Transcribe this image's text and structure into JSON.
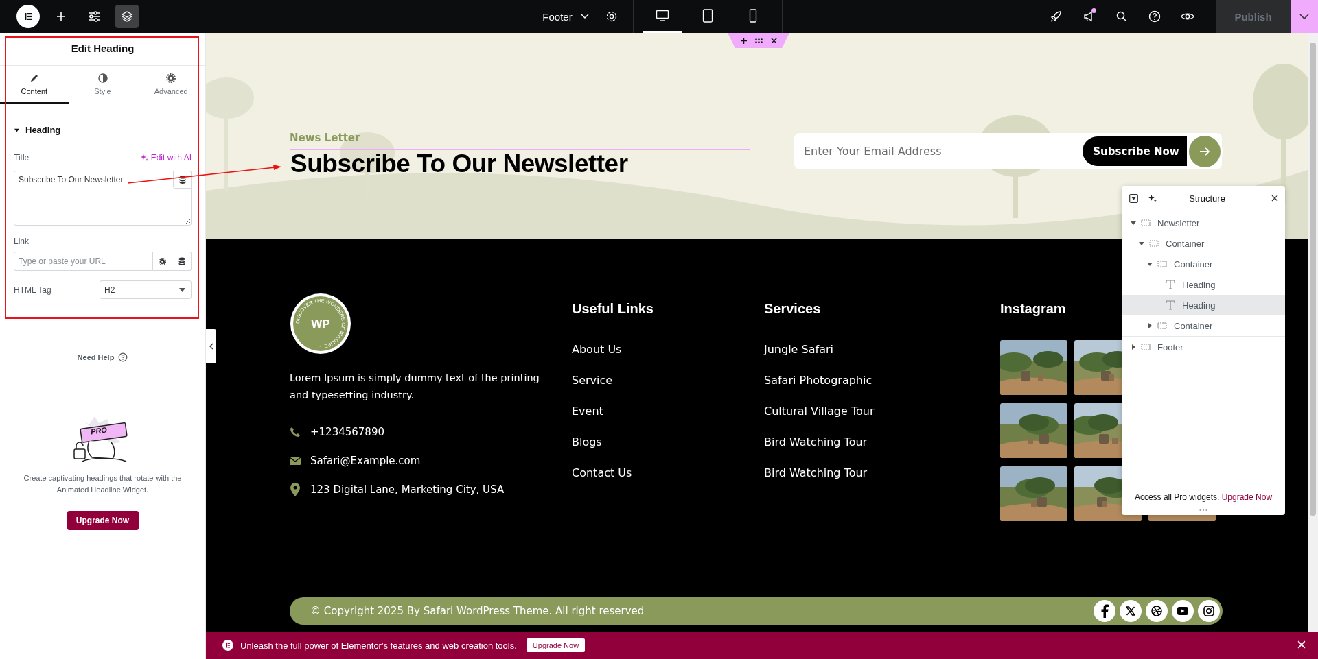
{
  "top_bar": {
    "left_tools": [
      {
        "kind": "add",
        "selected": false
      },
      {
        "kind": "sliders",
        "selected": false
      },
      {
        "kind": "layers",
        "selected": true
      }
    ],
    "document": {
      "title": "Footer"
    },
    "devices": [
      {
        "kind": "desktop",
        "selected": true
      },
      {
        "kind": "tablet",
        "selected": false
      },
      {
        "kind": "mobile",
        "selected": false
      }
    ],
    "right_tools": [
      {
        "kind": "rocket",
        "badge": false
      },
      {
        "kind": "megaphone",
        "badge": true
      },
      {
        "kind": "search",
        "badge": false
      },
      {
        "kind": "help",
        "badge": false
      },
      {
        "kind": "preview",
        "badge": false
      }
    ],
    "publish": {
      "label": "Publish",
      "disabled": true
    }
  },
  "panel": {
    "title": "Edit Heading",
    "tabs": [
      {
        "label": "Content",
        "kind": "pencil",
        "selected": true
      },
      {
        "label": "Style",
        "kind": "contrast",
        "selected": false
      },
      {
        "label": "Advanced",
        "kind": "gear",
        "selected": false
      }
    ],
    "section": {
      "title": "Heading",
      "expanded": true
    },
    "title_field": {
      "label": "Title",
      "ai_action": "Edit with AI",
      "value": "Subscribe To Our Newsletter"
    },
    "link_field": {
      "label": "Link",
      "placeholder": "Type or paste your URL"
    },
    "tag_field": {
      "label": "HTML Tag",
      "value": "H2"
    },
    "help": "Need Help",
    "promo": {
      "badge": "PRO",
      "text": "Create captivating headings that rotate with the Animated Headline Widget.",
      "button": "Upgrade Now"
    }
  },
  "newsletter": {
    "eyebrow": "News Letter",
    "heading": "Subscribe To Our Newsletter",
    "email_placeholder": "Enter Your Email Address",
    "button": "Subscribe Now"
  },
  "footer": {
    "logo": {
      "initials": "WP",
      "ring_text": "DISCOVER THE WONDERS OF WILDLIFE --"
    },
    "about": "Lorem Ipsum is simply dummy text of the printing and typesetting industry.",
    "contacts": [
      {
        "kind": "phone",
        "text": "+1234567890"
      },
      {
        "kind": "email",
        "text": "Safari@Example.com"
      },
      {
        "kind": "location",
        "text": "123 Digital Lane, Marketing City, USA"
      }
    ],
    "columns": [
      {
        "title": "Useful Links",
        "links": [
          "About Us",
          "Service",
          "Event",
          "Blogs",
          "Contact Us"
        ]
      },
      {
        "title": "Services",
        "links": [
          "Jungle Safari",
          "Safari Photographic",
          "Cultural Village Tour",
          "Bird Watching Tour",
          "Bird Watching Tour"
        ]
      }
    ],
    "instagram": {
      "title": "Instagram",
      "photos": [
        {
          "kind": "picture"
        },
        {
          "kind": "picture"
        },
        {
          "kind": "covered"
        },
        {
          "kind": "picture"
        },
        {
          "kind": "picture"
        },
        {
          "kind": "covered"
        },
        {
          "kind": "picture"
        },
        {
          "kind": "picture"
        },
        {
          "kind": "picture"
        }
      ]
    },
    "copyright": "© Copyright 2025 By Safari WordPress Theme. All right reserved",
    "socials": [
      {
        "kind": "facebook"
      },
      {
        "kind": "x"
      },
      {
        "kind": "dribbble"
      },
      {
        "kind": "youtube"
      },
      {
        "kind": "instagram"
      }
    ]
  },
  "structure": {
    "title": "Structure",
    "tree": [
      {
        "label": "Newsletter",
        "kind": "container",
        "expanded": true,
        "selected": false,
        "children": [
          {
            "label": "Container",
            "kind": "container",
            "expanded": true,
            "selected": false,
            "children": [
              {
                "label": "Container",
                "kind": "container",
                "expanded": true,
                "selected": false,
                "children": [
                  {
                    "label": "Heading",
                    "kind": "heading",
                    "selected": false
                  },
                  {
                    "label": "Heading",
                    "kind": "heading",
                    "selected": true
                  }
                ]
              },
              {
                "label": "Container",
                "kind": "container",
                "expanded": false,
                "selected": false
              }
            ]
          }
        ]
      },
      {
        "label": "Footer",
        "kind": "container",
        "expanded": false,
        "selected": false
      }
    ],
    "footer_text": "Access all Pro widgets.",
    "footer_link": "Upgrade Now"
  },
  "promo_bar": {
    "text": "Unleash the full power of Elementor's features and web creation tools.",
    "button": "Upgrade Now"
  }
}
